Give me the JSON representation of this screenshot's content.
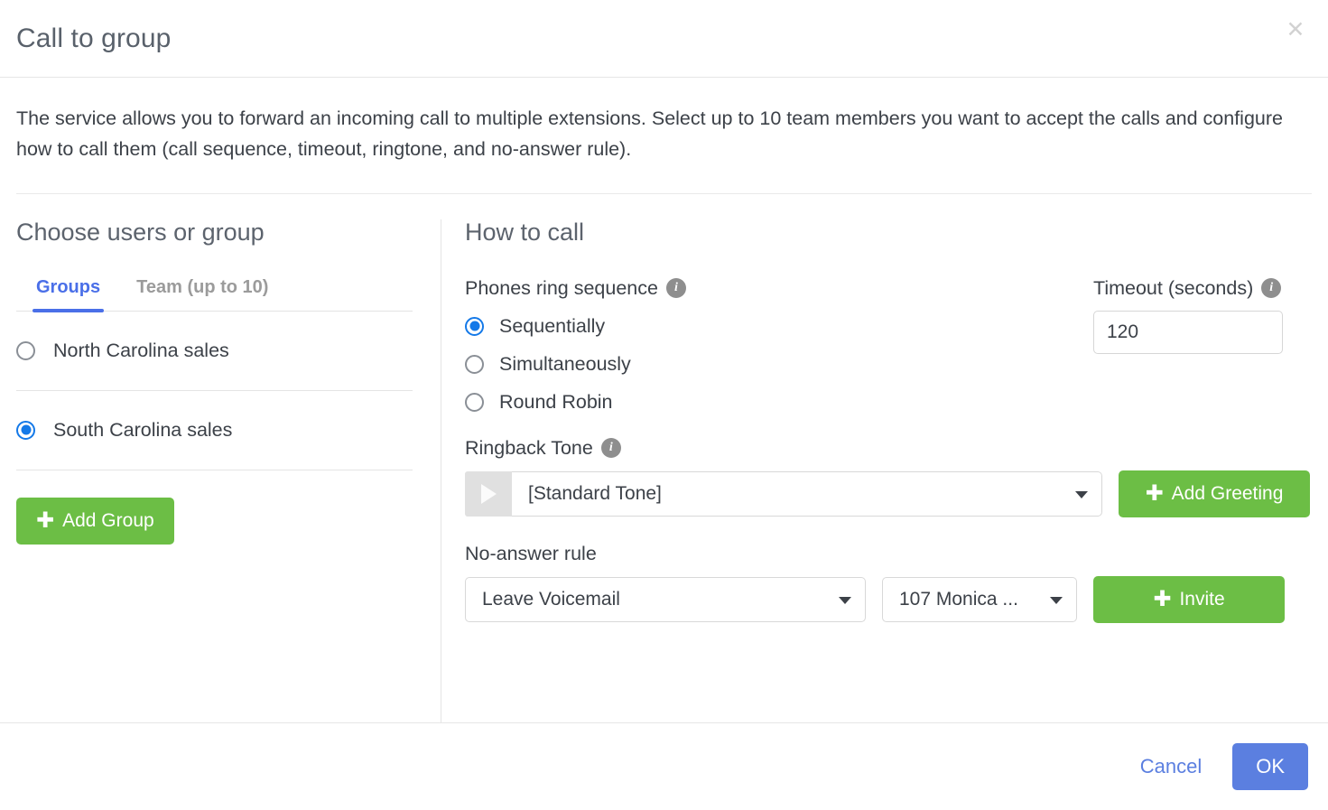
{
  "dialog": {
    "title": "Call to group",
    "close_icon": "close-icon",
    "description": "The service allows you to forward an incoming call to multiple extensions. Select up to 10 team members you want to accept the calls and configure how to call them (call sequence, timeout, ringtone, and no-answer rule)."
  },
  "left_panel": {
    "title": "Choose users or group",
    "tabs": [
      {
        "label": "Groups",
        "active": true
      },
      {
        "label": "Team (up to 10)",
        "active": false
      }
    ],
    "groups": [
      {
        "label": "North Carolina sales",
        "selected": false
      },
      {
        "label": "South Carolina sales",
        "selected": true
      }
    ],
    "add_group_label": "Add Group",
    "add_group_icon": "plus-icon"
  },
  "right_panel": {
    "title": "How to call",
    "ring_sequence": {
      "label": "Phones ring sequence",
      "info_icon": "info-icon",
      "options": [
        {
          "label": "Sequentially",
          "selected": true
        },
        {
          "label": "Simultaneously",
          "selected": false
        },
        {
          "label": "Round Robin",
          "selected": false
        }
      ]
    },
    "timeout": {
      "label": "Timeout (seconds)",
      "info_icon": "info-icon",
      "value": "120"
    },
    "ringback": {
      "label": "Ringback Tone",
      "info_icon": "info-icon",
      "play_icon": "play-icon",
      "selected": "[Standard Tone]",
      "add_greeting_label": "Add Greeting",
      "add_greeting_icon": "plus-icon"
    },
    "no_answer": {
      "label": "No-answer rule",
      "action_selected": "Leave Voicemail",
      "target_selected": "107 Monica ...",
      "invite_label": "Invite",
      "invite_icon": "plus-icon"
    }
  },
  "footer": {
    "cancel_label": "Cancel",
    "ok_label": "OK"
  },
  "colors": {
    "accent_blue": "#4a6fe8",
    "primary_blue": "#5b7fe0",
    "radio_blue": "#1479e8",
    "green": "#6cbe45",
    "text": "#3c4148",
    "muted": "#9b9b9b"
  }
}
